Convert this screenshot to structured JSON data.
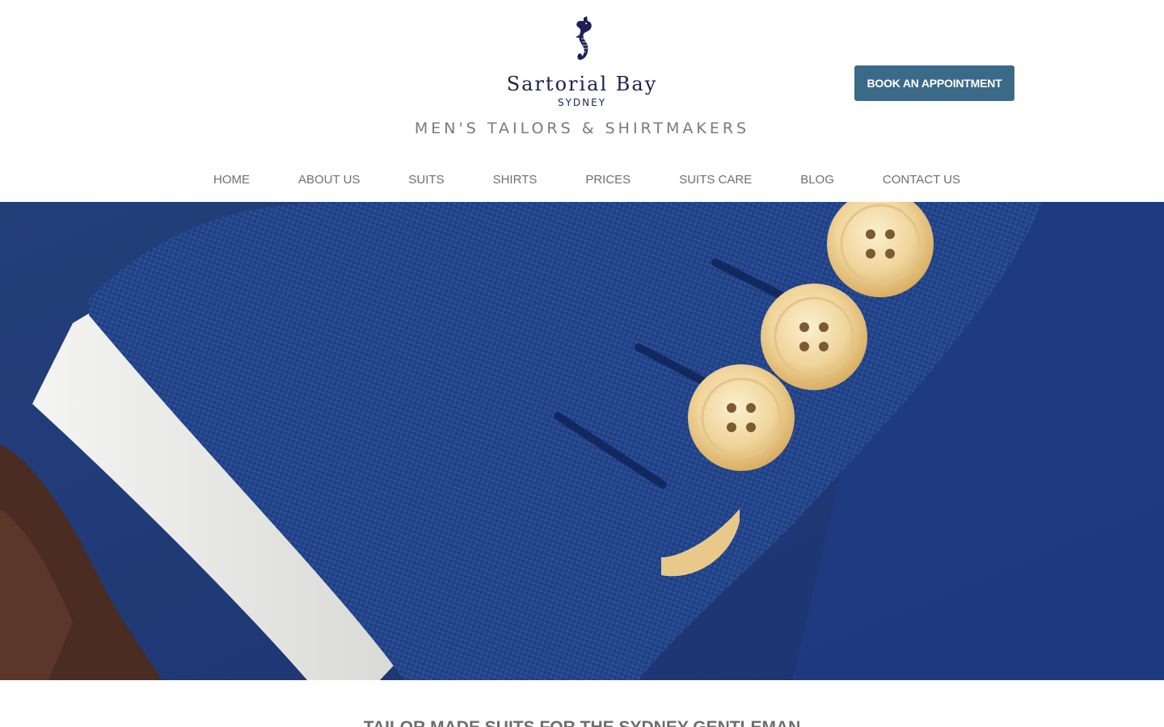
{
  "brand": {
    "name": "Sartorial Bay",
    "city": "SYDNEY",
    "tagline": "MEN'S TAILORS & SHIRTMAKERS",
    "logo_icon": "seahorse-icon",
    "color": "#1e1f55"
  },
  "header": {
    "book_button": "BOOK AN APPOINTMENT",
    "button_color": "#3b6a88"
  },
  "nav": {
    "items": [
      {
        "label": "HOME"
      },
      {
        "label": "ABOUT US"
      },
      {
        "label": "SUITS"
      },
      {
        "label": "SHIRTS"
      },
      {
        "label": "PRICES"
      },
      {
        "label": "SUITS CARE"
      },
      {
        "label": "BLOG"
      },
      {
        "label": "CONTACT US"
      }
    ]
  },
  "main": {
    "headline": "TAILOR MADE SUITS FOR THE SYDNEY GENTLEMAN"
  }
}
